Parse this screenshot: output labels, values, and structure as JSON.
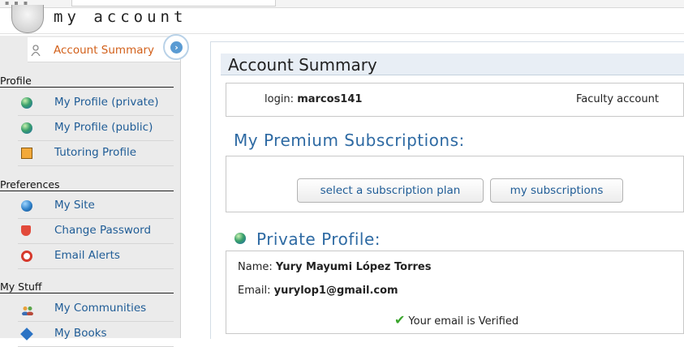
{
  "app": {
    "title": "my account"
  },
  "sidebar": {
    "active_item": {
      "label": "Account Summary",
      "icon": "person-icon"
    },
    "sections": [
      {
        "title": "Profile",
        "items": [
          {
            "label": "My Profile (private)",
            "icon": "globe-icon"
          },
          {
            "label": "My Profile (public)",
            "icon": "globe-icon"
          },
          {
            "label": "Tutoring Profile",
            "icon": "card-icon"
          }
        ]
      },
      {
        "title": "Preferences",
        "items": [
          {
            "label": "My Site",
            "icon": "globe-icon"
          },
          {
            "label": "Change Password",
            "icon": "shield-icon"
          },
          {
            "label": "Email Alerts",
            "icon": "clock-icon"
          }
        ]
      },
      {
        "title": "My Stuff",
        "items": [
          {
            "label": "My Communities",
            "icon": "people-icon"
          },
          {
            "label": "My Books",
            "icon": "book-icon"
          }
        ]
      }
    ]
  },
  "main": {
    "title": "Account Summary",
    "login": {
      "label": "login:",
      "value": "marcos141",
      "account_type": "Faculty account"
    },
    "subscriptions": {
      "heading": "My Premium Subscriptions:",
      "select_plan_label": "select a subscription plan",
      "my_subscriptions_label": "my subscriptions"
    },
    "private_profile": {
      "heading": "Private Profile:",
      "name_label": "Name:",
      "name_value": "Yury Mayumi López Torres",
      "email_label": "Email:",
      "email_value": "yurylop1@gmail.com",
      "verified_text": "Your email is Verified"
    }
  }
}
